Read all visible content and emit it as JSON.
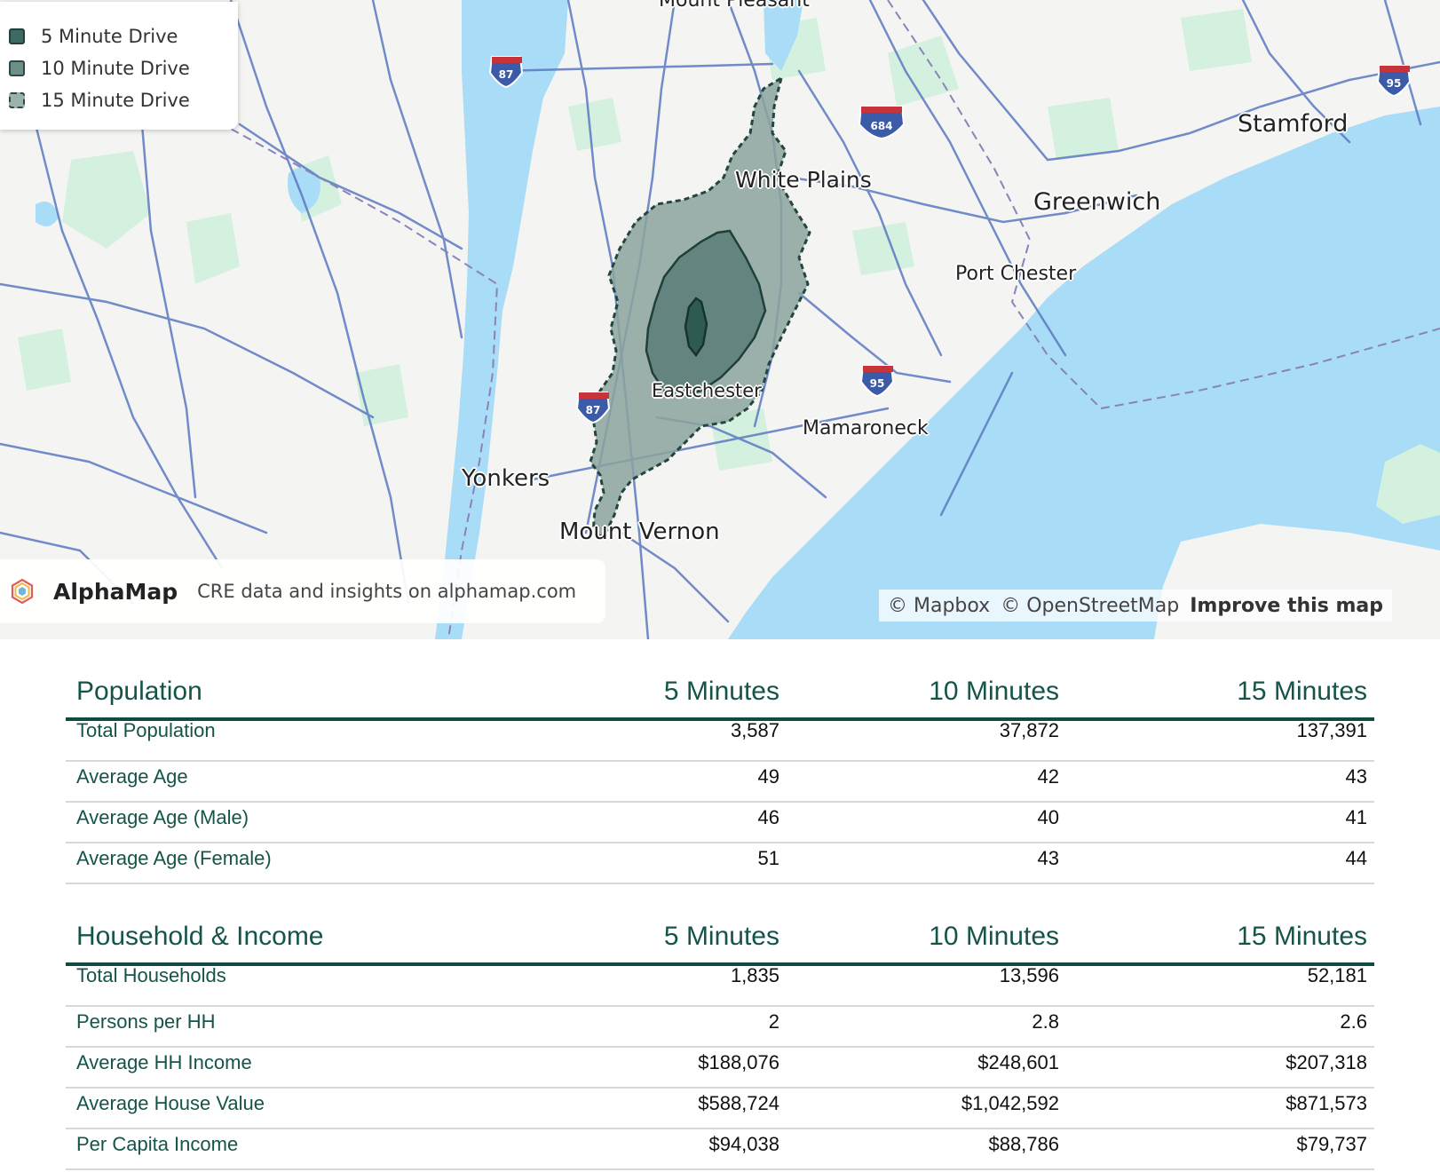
{
  "map": {
    "legend": [
      {
        "label": "5 Minute Drive"
      },
      {
        "label": "10 Minute Drive"
      },
      {
        "label": "15 Minute Drive"
      }
    ],
    "places": {
      "mount_pleasant": "Mount Pleasant",
      "white_plains": "White Plains",
      "stamford": "Stamford",
      "greenwich": "Greenwich",
      "port_chester": "Port Chester",
      "eastchester": "Eastchester",
      "mamaroneck": "Mamaroneck",
      "yonkers": "Yonkers",
      "mount_vernon": "Mount Vernon"
    },
    "shields": {
      "i87_north": "87",
      "i87_south": "87",
      "i684": "684",
      "i95_east": "95",
      "i95_south": "95"
    },
    "brand": {
      "name": "AlphaMap",
      "tagline": "CRE data and insights on alphamap.com"
    },
    "attribution": {
      "mapbox": "© Mapbox",
      "osm": "© OpenStreetMap",
      "improve": "Improve this map"
    },
    "colors": {
      "water": "#a8dcf7",
      "park": "#d4f0df",
      "road": "#5b79c2",
      "drive_5": "#3d6a64",
      "drive_10": "#6e8e89",
      "drive_15": "#9bb1ad"
    }
  },
  "population": {
    "title": "Population",
    "columns": [
      "5 Minutes",
      "10 Minutes",
      "15 Minutes"
    ],
    "rows": [
      {
        "label": "Total Population",
        "values": [
          "3,587",
          "37,872",
          "137,391"
        ]
      },
      {
        "label": "Average Age",
        "values": [
          "49",
          "42",
          "43"
        ]
      },
      {
        "label": "Average Age (Male)",
        "values": [
          "46",
          "40",
          "41"
        ]
      },
      {
        "label": "Average Age (Female)",
        "values": [
          "51",
          "43",
          "44"
        ]
      }
    ]
  },
  "household": {
    "title": "Household & Income",
    "columns": [
      "5 Minutes",
      "10 Minutes",
      "15 Minutes"
    ],
    "rows": [
      {
        "label": "Total Households",
        "values": [
          "1,835",
          "13,596",
          "52,181"
        ]
      },
      {
        "label": "Persons per HH",
        "values": [
          "2",
          "2.8",
          "2.6"
        ]
      },
      {
        "label": "Average HH Income",
        "values": [
          "$188,076",
          "$248,601",
          "$207,318"
        ]
      },
      {
        "label": "Average House Value",
        "values": [
          "$588,724",
          "$1,042,592",
          "$871,573"
        ]
      },
      {
        "label": "Per Capita Income",
        "values": [
          "$94,038",
          "$88,786",
          "$79,737"
        ]
      }
    ]
  }
}
